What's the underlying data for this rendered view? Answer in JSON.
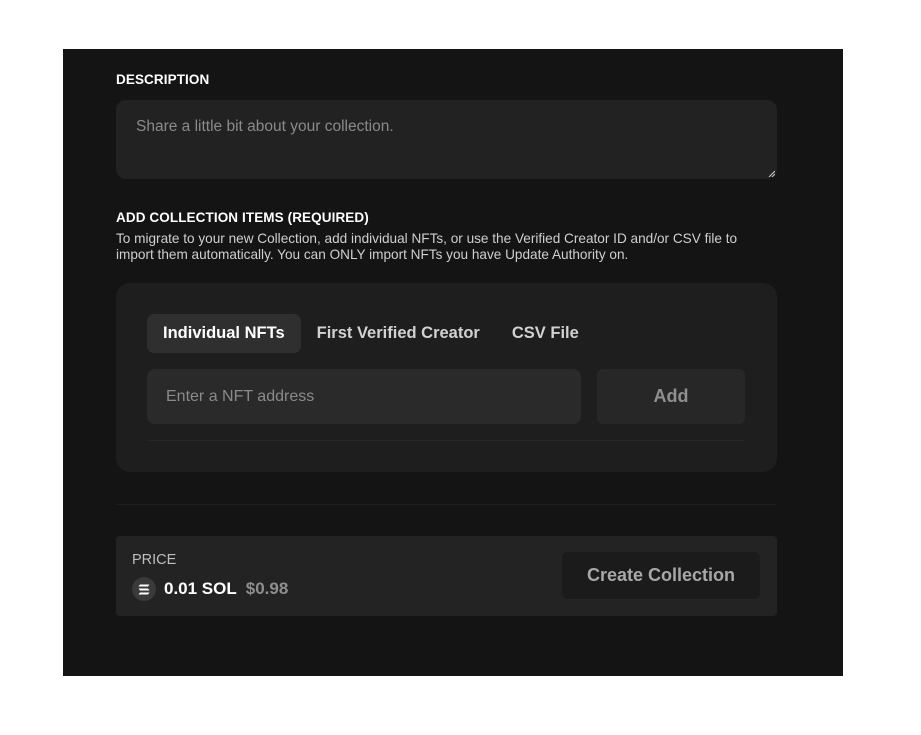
{
  "description": {
    "label": "DESCRIPTION",
    "placeholder": "Share a little bit about your collection."
  },
  "collection_items": {
    "label": "ADD COLLECTION ITEMS (REQUIRED)",
    "help_text": "To migrate to your new Collection, add individual NFTs, or use the Verified Creator ID and/or CSV file to import them automatically. You can ONLY import NFTs you have Update Authority on.",
    "tabs": [
      {
        "label": "Individual NFTs",
        "active": true
      },
      {
        "label": "First Verified Creator",
        "active": false
      },
      {
        "label": "CSV File",
        "active": false
      }
    ],
    "input_placeholder": "Enter a NFT address",
    "add_label": "Add"
  },
  "price": {
    "label": "PRICE",
    "icon": "solana-icon",
    "sol_amount": "0.01 SOL",
    "usd_amount": "$0.98"
  },
  "create_button_label": "Create Collection",
  "colors": {
    "panel_bg": "#141414",
    "field_bg": "#222222",
    "text_primary": "#ffffff",
    "text_muted": "#8a8a8a"
  }
}
